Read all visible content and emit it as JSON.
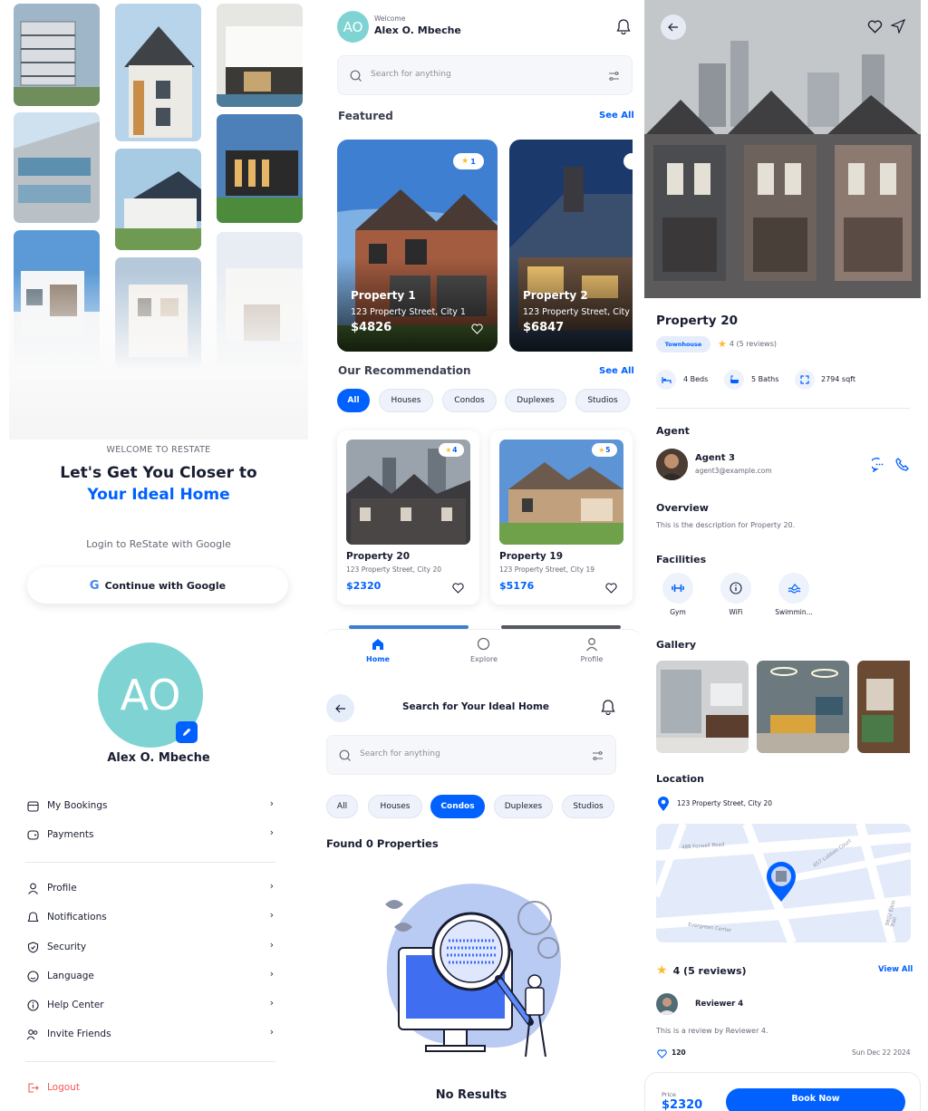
{
  "onboarding": {
    "welcome": "WELCOME TO RESTATE",
    "headline_1": "Let's Get You Closer to",
    "headline_2": "Your Ideal Home",
    "login_prompt": "Login to ReState with Google",
    "google_button": "Continue with Google"
  },
  "home": {
    "welcome_label": "Welcome",
    "user_name": "Alex O. Mbeche",
    "avatar_initials": "AO",
    "search_placeholder": "Search for anything",
    "featured_title": "Featured",
    "see_all": "See All",
    "featured": [
      {
        "name": "Property 1",
        "address": "123 Property Street, City 1",
        "price": "$4826",
        "rating": "1"
      },
      {
        "name": "Property 2",
        "address": "123 Property Street, City",
        "price": "$6847"
      }
    ],
    "recommendation_title": "Our Recommendation",
    "filters": [
      "All",
      "Houses",
      "Condos",
      "Duplexes",
      "Studios"
    ],
    "recommendations": [
      {
        "name": "Property 20",
        "address": "123 Property Street, City 20",
        "price": "$2320",
        "rating": "4"
      },
      {
        "name": "Property 19",
        "address": "123 Property Street, City 19",
        "price": "$5176",
        "rating": "5"
      }
    ],
    "tabs": [
      "Home",
      "Explore",
      "Profile"
    ]
  },
  "profile": {
    "avatar_initials": "AO",
    "name": "Alex O. Mbeche",
    "menu_group_1": [
      "My Bookings",
      "Payments"
    ],
    "menu_group_2": [
      "Profile",
      "Notifications",
      "Security",
      "Language",
      "Help Center",
      "Invite Friends"
    ],
    "logout": "Logout"
  },
  "search": {
    "title": "Search for Your Ideal Home",
    "search_placeholder": "Search for anything",
    "filters": [
      "All",
      "Houses",
      "Condos",
      "Duplexes",
      "Studios"
    ],
    "active_filter": "Condos",
    "found_text": "Found 0 Properties",
    "no_results": "No Results"
  },
  "detail": {
    "name": "Property 20",
    "type": "Townhouse",
    "rating_text": "4 (5 reviews)",
    "beds": "4 Beds",
    "baths": "5 Baths",
    "area": "2794 sqft",
    "agent_title": "Agent",
    "agent_name": "Agent 3",
    "agent_email": "agent3@example.com",
    "overview_title": "Overview",
    "overview_text": "This is the description for Property 20.",
    "facilities_title": "Facilities",
    "facilities": [
      "Gym",
      "WiFi",
      "Swimmin..."
    ],
    "gallery_title": "Gallery",
    "location_title": "Location",
    "address": "123 Property Street, City 20",
    "map_streets": [
      "488 Forwell Road",
      "657 Lubbon Court",
      "Evergreen Center",
      "9802 Elkin Trail"
    ],
    "reviews_title": "4 (5 reviews)",
    "view_all": "View All",
    "reviewer_name": "Reviewer 4",
    "review_text": "This is a review by Reviewer 4.",
    "review_likes": "120",
    "review_date": "Sun Dec 22 2024",
    "price_label": "Price",
    "price": "$2320",
    "book_button": "Book Now"
  },
  "colors": {
    "primary": "#0061ff",
    "text": "#191d31",
    "muted": "#666876",
    "chip_bg": "#eef2fb",
    "avatar": "#7fd4d3",
    "logout": "#f75555"
  }
}
